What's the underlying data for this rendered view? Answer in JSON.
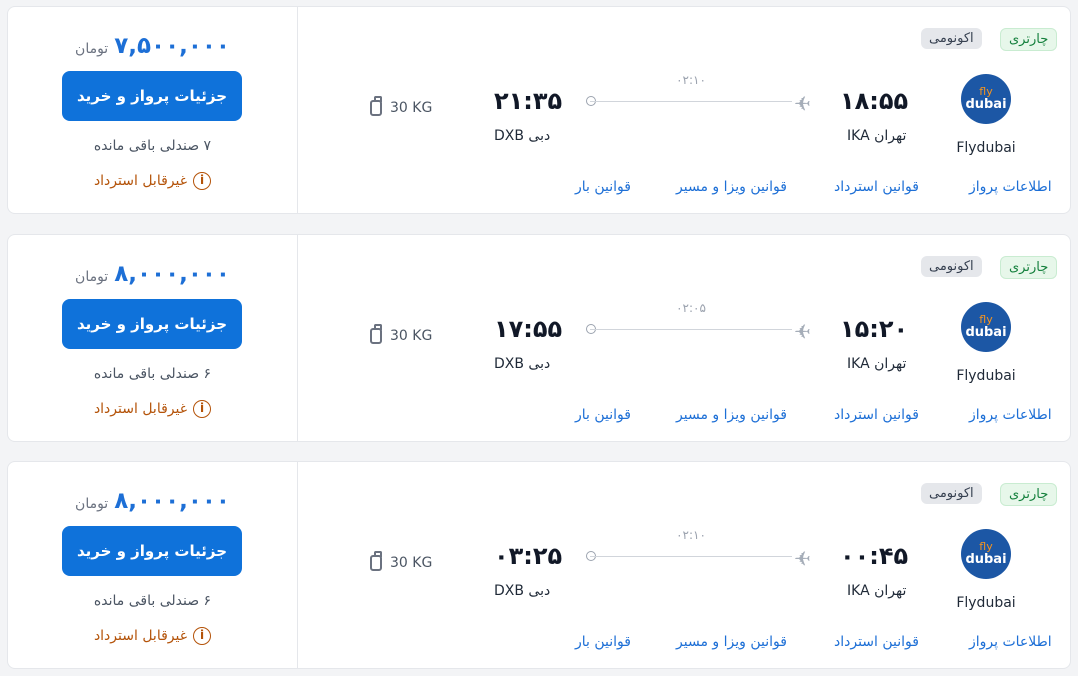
{
  "currency": "تومان",
  "buy_label": "جزئیات پرواز و خرید",
  "refund_label": "غیرقابل استرداد",
  "refund_icon": "info-icon",
  "seats_suffix": "صندلی باقی مانده",
  "links": {
    "flight_info": "اطلاعات پرواز",
    "refund_rules": "قوانین استرداد",
    "visa_rules": "قوانین ویزا و مسیر",
    "baggage_rules": "قوانین بار"
  },
  "colors": {
    "accent": "#0f72da",
    "refund": "#b45309",
    "charter": "#15803d"
  },
  "flights": [
    {
      "price": "۷,۵۰۰,۰۰۰",
      "seats": "۷",
      "baggage": "30 KG",
      "dep_time": "۱۸:۵۵",
      "dep_city": "تهران IKA",
      "arr_time": "۲۱:۳۵",
      "arr_city": "دبی DXB",
      "duration": "۰۲:۱۰",
      "airline": "Flydubai",
      "logo_top": "fly",
      "logo_bottom": "dubai",
      "badge_charter": "چارتری",
      "badge_class": "اکونومی"
    },
    {
      "price": "۸,۰۰۰,۰۰۰",
      "seats": "۶",
      "baggage": "30 KG",
      "dep_time": "۱۵:۲۰",
      "dep_city": "تهران IKA",
      "arr_time": "۱۷:۵۵",
      "arr_city": "دبی DXB",
      "duration": "۰۲:۰۵",
      "airline": "Flydubai",
      "logo_top": "fly",
      "logo_bottom": "dubai",
      "badge_charter": "چارتری",
      "badge_class": "اکونومی"
    },
    {
      "price": "۸,۰۰۰,۰۰۰",
      "seats": "۶",
      "baggage": "30 KG",
      "dep_time": "۰۰:۴۵",
      "dep_city": "تهران IKA",
      "arr_time": "۰۳:۲۵",
      "arr_city": "دبی DXB",
      "duration": "۰۲:۱۰",
      "airline": "Flydubai",
      "logo_top": "fly",
      "logo_bottom": "dubai",
      "badge_charter": "چارتری",
      "badge_class": "اکونومی"
    }
  ]
}
